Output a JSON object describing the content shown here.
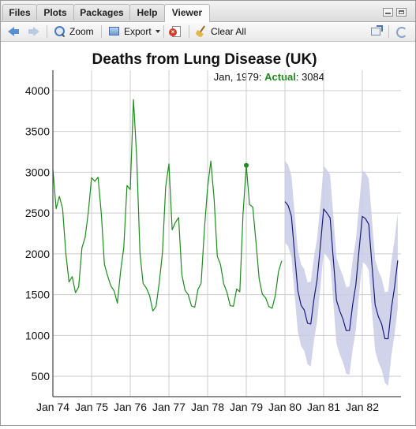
{
  "tabs": [
    {
      "label": "Files",
      "active": false
    },
    {
      "label": "Plots",
      "active": false
    },
    {
      "label": "Packages",
      "active": false
    },
    {
      "label": "Help",
      "active": false
    },
    {
      "label": "Viewer",
      "active": true
    }
  ],
  "toolbar": {
    "zoom_label": "Zoom",
    "export_label": "Export",
    "clear_label": "Clear All"
  },
  "colors": {
    "actual": "#1f8a1f",
    "forecast": "#1a1a7a",
    "band": "#c9cbe8",
    "grid": "#cccccc"
  },
  "chart_data": {
    "type": "line",
    "title": "Deaths from Lung Disease (UK)",
    "legend": {
      "date": "Jan, 1979",
      "series_name": "Actual",
      "value": "3084"
    },
    "xlabel": "",
    "ylabel": "",
    "xlim": [
      1974.0,
      1983.0
    ],
    "ylim": [
      250,
      4250
    ],
    "y_ticks": [
      500,
      1000,
      1500,
      2000,
      2500,
      3000,
      3500,
      4000
    ],
    "x_ticks": [
      {
        "value": 1974,
        "label": "Jan 74"
      },
      {
        "value": 1975,
        "label": "Jan 75"
      },
      {
        "value": 1976,
        "label": "Jan 76"
      },
      {
        "value": 1977,
        "label": "Jan 77"
      },
      {
        "value": 1978,
        "label": "Jan 78"
      },
      {
        "value": 1979,
        "label": "Jan 79"
      },
      {
        "value": 1980,
        "label": "Jan 80"
      },
      {
        "value": 1981,
        "label": "Jan 81"
      },
      {
        "value": 1982,
        "label": "Jan 82"
      }
    ],
    "grid": true,
    "highlight": {
      "x": 1979.0,
      "y": 3084
    },
    "series": [
      {
        "name": "Actual",
        "start": 1974.0,
        "values": [
          3035,
          2552,
          2704,
          2554,
          2014,
          1655,
          1721,
          1524,
          1596,
          2074,
          2199,
          2512,
          2933,
          2889,
          2938,
          2497,
          1870,
          1726,
          1607,
          1545,
          1396,
          1787,
          2076,
          2837,
          2787,
          3891,
          3179,
          2011,
          1636,
          1580,
          1489,
          1300,
          1356,
          1653,
          2013,
          2823,
          3102,
          2294,
          2385,
          2444,
          1748,
          1554,
          1498,
          1361,
          1346,
          1564,
          1640,
          2293,
          2815,
          3137,
          2679,
          1969,
          1870,
          1633,
          1529,
          1366,
          1357,
          1570,
          1535,
          2491,
          3084,
          2605,
          2573,
          2143,
          1693,
          1504,
          1461,
          1354,
          1333,
          1492,
          1781,
          1915
        ]
      },
      {
        "name": "Forecast",
        "start": 1980.0,
        "values": [
          2640,
          2590,
          2460,
          1990,
          1550,
          1370,
          1310,
          1150,
          1140,
          1450,
          1690,
          2100,
          2550,
          2500,
          2440,
          1930,
          1430,
          1300,
          1200,
          1060,
          1060,
          1380,
          1620,
          2050,
          2460,
          2430,
          2360,
          1850,
          1370,
          1230,
          1140,
          960,
          960,
          1330,
          1590,
          1920
        ]
      }
    ],
    "band": {
      "start": 1980.0,
      "upper": [
        3140,
        3090,
        2960,
        2490,
        2050,
        1870,
        1810,
        1650,
        1660,
        1960,
        2200,
        2610,
        3080,
        3030,
        2970,
        2460,
        1960,
        1830,
        1730,
        1590,
        1600,
        1930,
        2170,
        2600,
        3020,
        2990,
        2920,
        2410,
        1930,
        1790,
        1700,
        1530,
        1540,
        1910,
        2170,
        2500
      ],
      "lower": [
        2140,
        2090,
        1960,
        1490,
        1050,
        870,
        810,
        650,
        620,
        940,
        1180,
        1590,
        2020,
        1970,
        1910,
        1400,
        900,
        770,
        670,
        530,
        520,
        830,
        1070,
        1500,
        1900,
        1870,
        1800,
        1290,
        810,
        670,
        580,
        420,
        380,
        750,
        1010,
        1340
      ]
    }
  }
}
